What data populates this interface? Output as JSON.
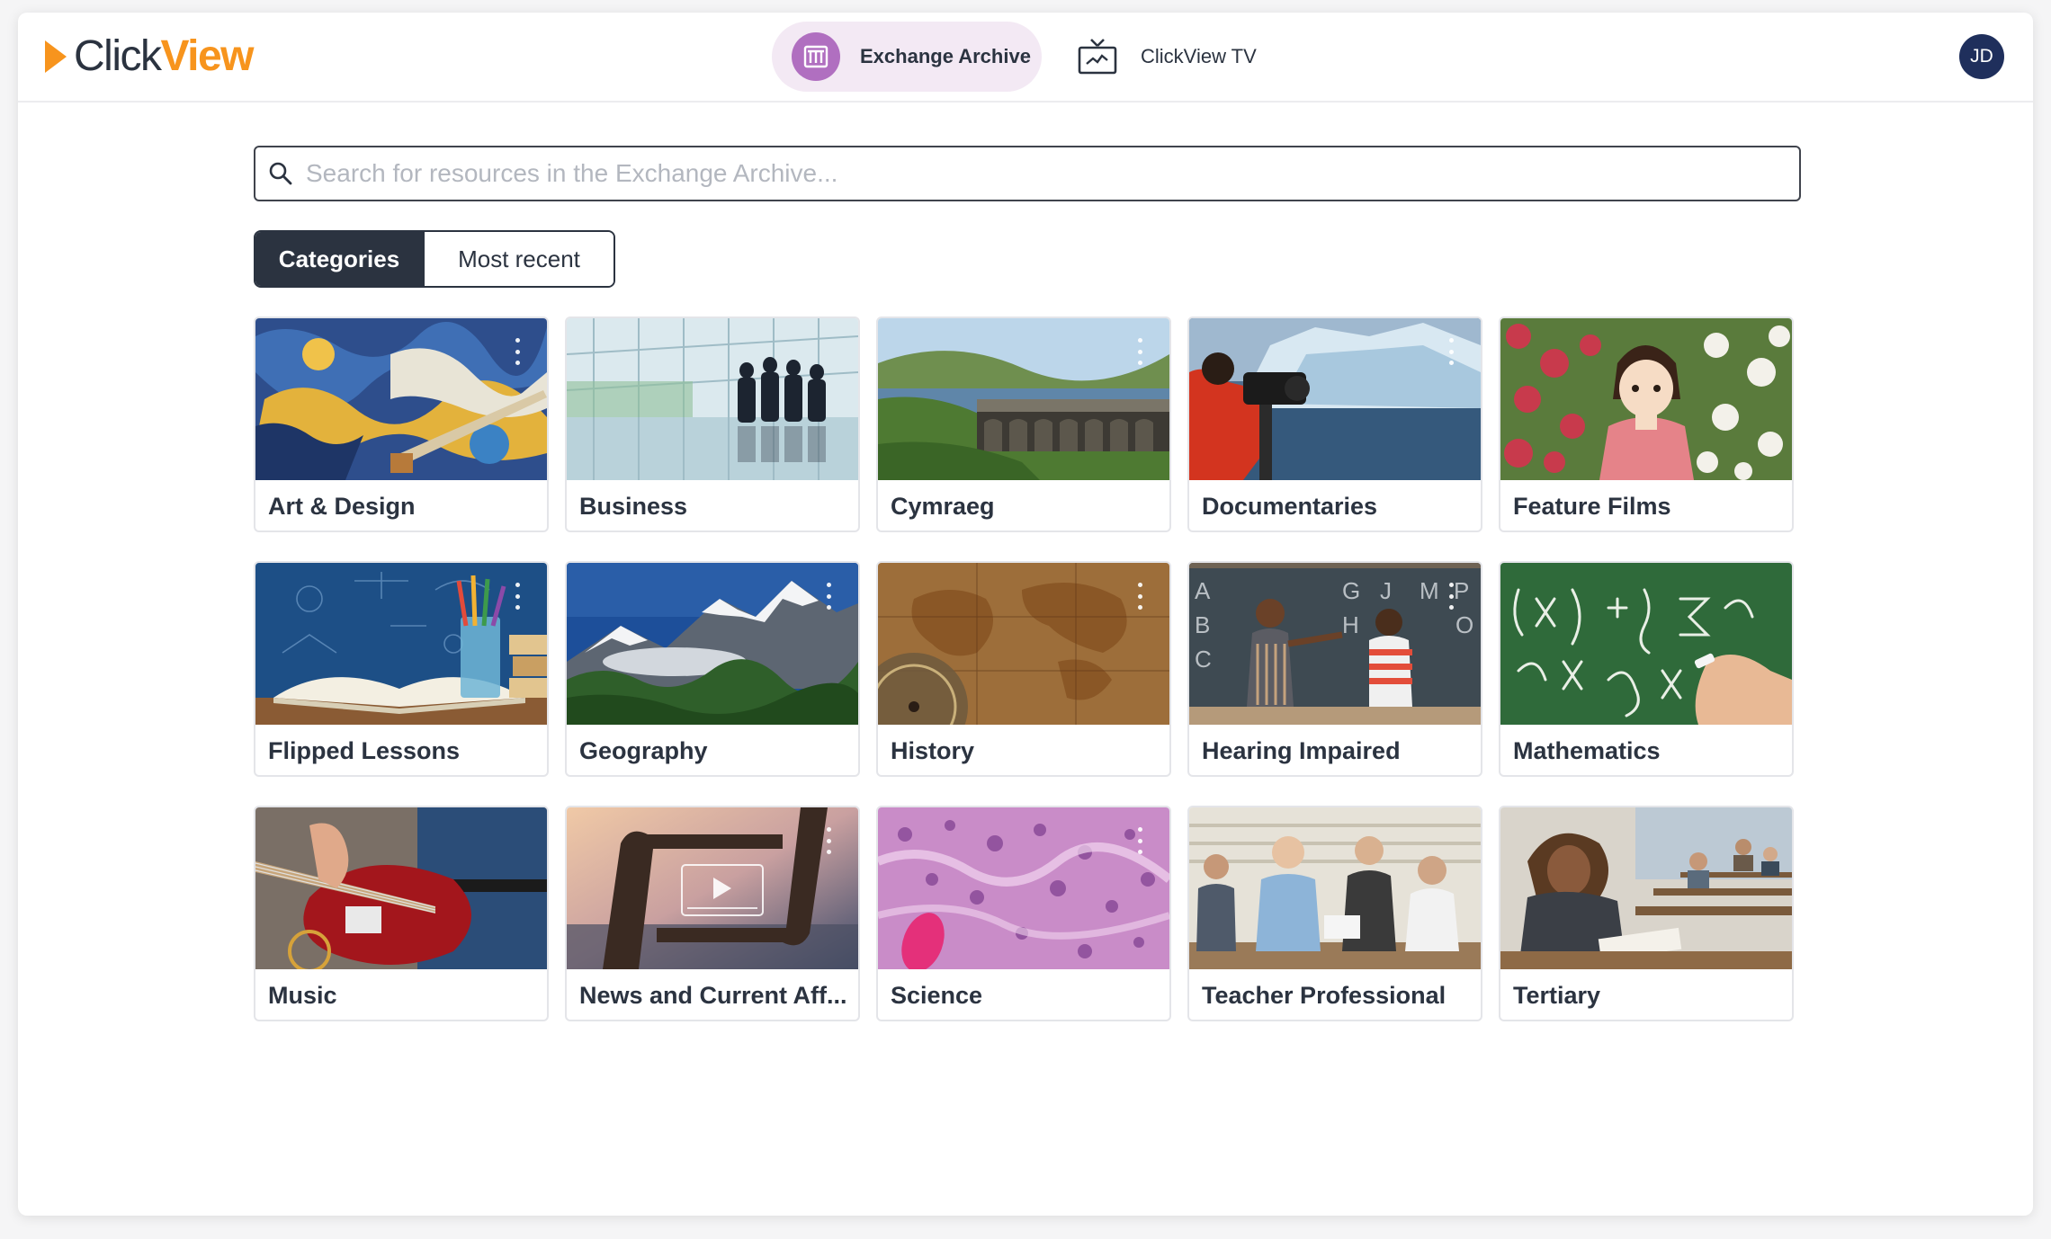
{
  "header": {
    "logo": {
      "part1": "Click",
      "part2": "View"
    },
    "nav": [
      {
        "label": "Exchange Archive",
        "icon": "archive-building-icon",
        "active": true,
        "accent": "#b06fc0"
      },
      {
        "label": "ClickView TV",
        "icon": "tv-icon",
        "active": false
      }
    ],
    "avatar_initials": "JD",
    "avatar_color": "#1f2f5c"
  },
  "search": {
    "placeholder": "Search for resources in the Exchange Archive...",
    "value": ""
  },
  "view_toggle": {
    "options": [
      "Categories",
      "Most recent"
    ],
    "selected": "Categories"
  },
  "colors": {
    "brand_orange": "#f7941d",
    "dark": "#2b3340",
    "pill_bg": "#f3e9f4"
  },
  "categories": [
    {
      "label": "Art & Design",
      "image": "abstract-paint-palette"
    },
    {
      "label": "Business",
      "image": "business-people-glass-office"
    },
    {
      "label": "Cymraeg",
      "image": "valley-dam-landscape"
    },
    {
      "label": "Documentaries",
      "image": "cameraman-iceberg"
    },
    {
      "label": "Feature Films",
      "image": "animated-girl-flowers"
    },
    {
      "label": "Flipped Lessons",
      "image": "open-book-pencils-chalkboard"
    },
    {
      "label": "Geography",
      "image": "snowy-mountains-forest"
    },
    {
      "label": "History",
      "image": "antique-world-map-compass"
    },
    {
      "label": "Hearing Impaired",
      "image": "teacher-student-chalkboard"
    },
    {
      "label": "Mathematics",
      "image": "green-chalkboard-equations"
    },
    {
      "label": "Music",
      "image": "red-electric-guitar"
    },
    {
      "label": "News and Current Aff...",
      "image": "hands-framing-video"
    },
    {
      "label": "Science",
      "image": "microscope-tissue-slide"
    },
    {
      "label": "Teacher Professional",
      "image": "teachers-collaborating"
    },
    {
      "label": "Tertiary",
      "image": "students-lecture-hall"
    }
  ]
}
